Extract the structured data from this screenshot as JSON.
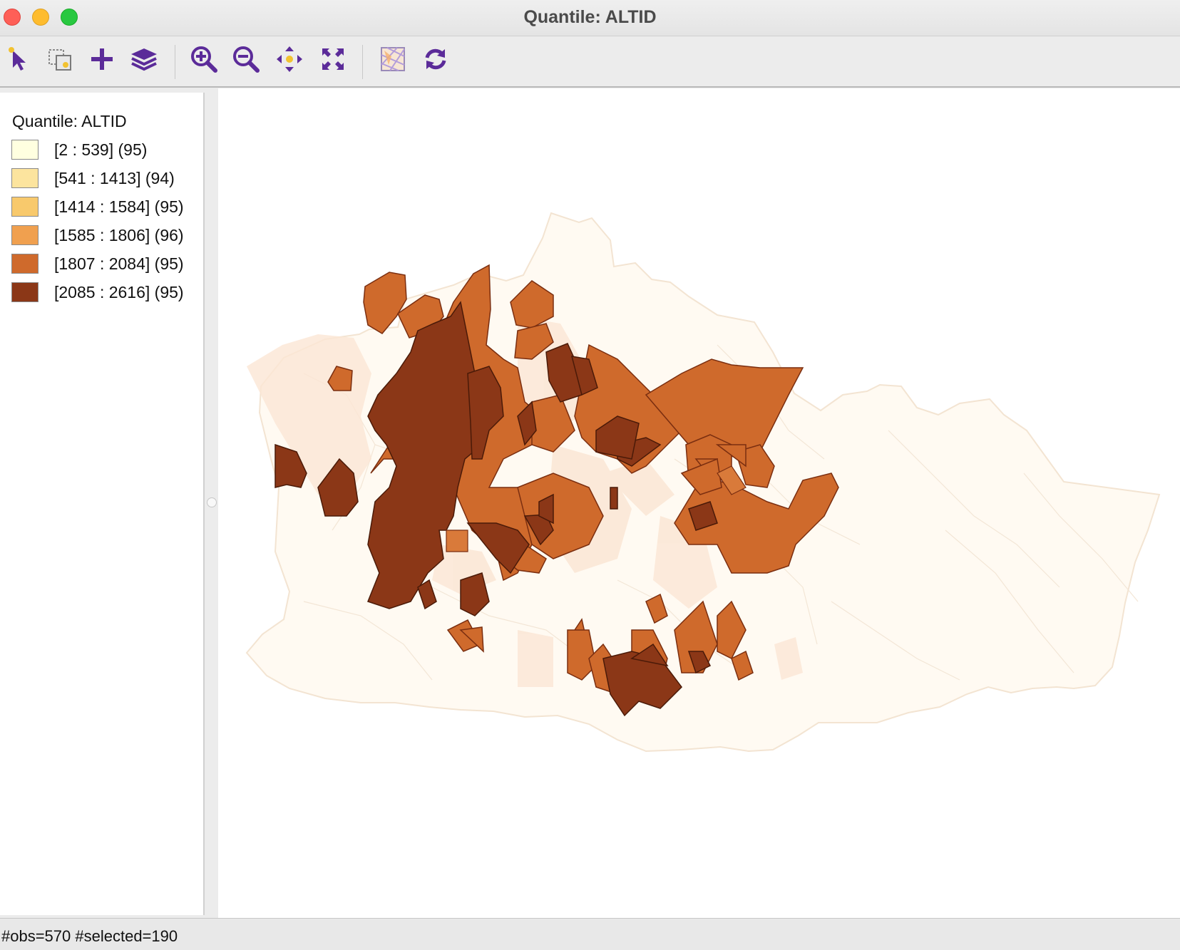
{
  "window": {
    "title": "Quantile: ALTID"
  },
  "toolbar": {
    "tools": [
      {
        "name": "select-tool",
        "icon": "select-pointer-icon"
      },
      {
        "name": "selection-shapes-tool",
        "icon": "selection-shapes-icon"
      },
      {
        "name": "add-tool",
        "icon": "plus-icon"
      },
      {
        "name": "layers-tool",
        "icon": "layers-icon"
      },
      {
        "name": "zoom-in-tool",
        "icon": "zoom-in-icon"
      },
      {
        "name": "zoom-out-tool",
        "icon": "zoom-out-icon"
      },
      {
        "name": "pan-tool",
        "icon": "pan-arrows-icon"
      },
      {
        "name": "full-extent-tool",
        "icon": "full-extent-icon"
      },
      {
        "name": "basemap-tool",
        "icon": "basemap-icon"
      },
      {
        "name": "refresh-tool",
        "icon": "refresh-icon"
      }
    ],
    "accent_color": "#5b2b99"
  },
  "legend": {
    "title": "Quantile: ALTID",
    "classes": [
      {
        "label": "[2 : 539] (95)",
        "color": "#ffffe0"
      },
      {
        "label": "[541 : 1413] (94)",
        "color": "#fce49e"
      },
      {
        "label": "[1414 : 1584] (95)",
        "color": "#f8c96c"
      },
      {
        "label": "[1585 : 1806] (96)",
        "color": "#f0a04f"
      },
      {
        "label": "[1807 : 2084] (95)",
        "color": "#cf6a2c"
      },
      {
        "label": "[2085 : 2616] (95)",
        "color": "#8b3717"
      }
    ]
  },
  "map": {
    "layer": "ALTID",
    "classification": "Quantile",
    "selection_highlight": "top and bottom classes shown, others faded",
    "base_fill": "#fffaf2",
    "selected_dark": "#8b3717",
    "selected_medium": "#cf6a2c"
  },
  "status": {
    "text": "#obs=570 #selected=190"
  }
}
